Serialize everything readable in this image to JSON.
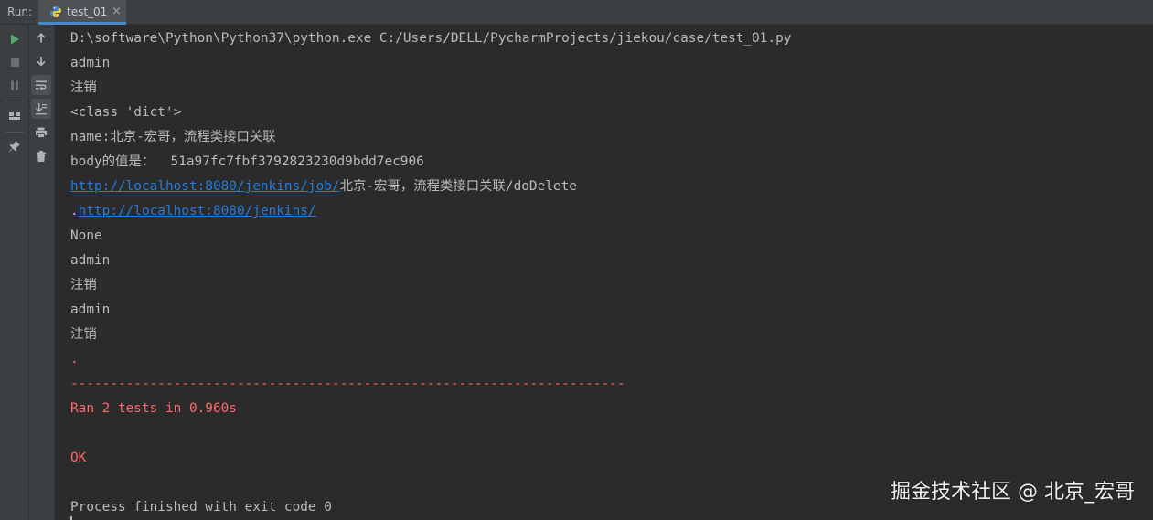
{
  "run_panel": {
    "label": "Run:",
    "tab": {
      "label": "test_01",
      "close": "×",
      "icon": "python-file-icon"
    }
  },
  "colors": {
    "stdout": "#bbbbbb",
    "stderr": "#ff6b68",
    "link": "#287bde",
    "background": "#2b2b2b",
    "toolbar": "#3c3f41"
  },
  "console": {
    "lines": [
      {
        "text": "D:\\software\\Python\\Python37\\python.exe C:/Users/DELL/PycharmProjects/jiekou/case/test_01.py"
      },
      {
        "text": "admin"
      },
      {
        "text": "注销"
      },
      {
        "text": "<class 'dict'>"
      },
      {
        "text": "name:北京-宏哥，流程类接口关联"
      },
      {
        "text": "body的值是：  51a97fc7fbf3792823230d9bdd7ec906"
      },
      {
        "link": "http://localhost:8080/jenkins/job/",
        "text": "北京-宏哥，流程类接口关联/doDelete"
      },
      {
        "prefix": ".",
        "link": "http://localhost:8080/jenkins/"
      },
      {
        "text": "None"
      },
      {
        "text": "admin"
      },
      {
        "text": "注销"
      },
      {
        "text": "admin"
      },
      {
        "text": "注销"
      },
      {
        "text": ".",
        "stream": "stderr"
      },
      {
        "text": "----------------------------------------------------------------------",
        "stream": "stderr"
      },
      {
        "text": "Ran 2 tests in 0.960s",
        "stream": "stderr"
      },
      {
        "text": "",
        "stream": "stderr"
      },
      {
        "text": "OK",
        "stream": "stderr"
      },
      {
        "text": ""
      },
      {
        "text": "Process finished with exit code 0"
      }
    ]
  },
  "toolbar_left": [
    {
      "name": "rerun-icon",
      "active": false
    },
    {
      "name": "stop-icon",
      "active": false
    },
    {
      "name": "pause-icon",
      "active": false
    },
    {
      "name": "layout-icon",
      "active": false
    },
    {
      "name": "pin-icon",
      "active": false
    }
  ],
  "toolbar_right": [
    {
      "name": "up-arrow-icon",
      "active": false
    },
    {
      "name": "down-arrow-icon",
      "active": false
    },
    {
      "name": "soft-wrap-icon",
      "active": true
    },
    {
      "name": "scroll-to-end-icon",
      "active": true
    },
    {
      "name": "print-icon",
      "active": false
    },
    {
      "name": "trash-icon",
      "active": false
    }
  ],
  "watermark": "掘金技术社区 @ 北京_宏哥"
}
